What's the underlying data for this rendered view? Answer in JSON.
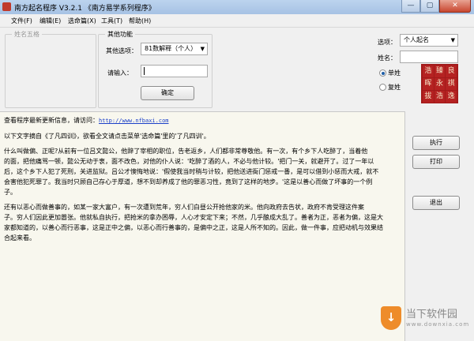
{
  "window": {
    "title": "南方起名程序 V3.2.1  《南方易学系列程序》",
    "controls": [
      "—",
      "▢",
      "✕"
    ]
  },
  "menu": [
    "文件(F)",
    "编辑(E)",
    "选命篇(X)",
    "工具(T)",
    "帮助(H)"
  ],
  "panels": {
    "names_group_title": "姓名五格",
    "other_group_title": "其他功能",
    "other_options_label": "其他选项：",
    "other_options_value": "81数解释（个人）",
    "input_label": "请输入：",
    "input_value": "",
    "confirm_button": "确定"
  },
  "right_panel": {
    "options_label": "选项：",
    "options_value": "个人起名",
    "surname_label": "姓名：",
    "surname_value": "",
    "radio_single": "单姓",
    "radio_double": "复姓",
    "radio_selected": "单姓",
    "logo_chars": [
      "浩",
      "臻",
      "良",
      "晖",
      "永",
      "祺",
      "拔",
      "浩",
      "逸"
    ],
    "execute_button": "执行",
    "print_button": "打印",
    "exit_button": "退出"
  },
  "content": {
    "update_prefix": "查看程序最新更新信息，请访问：",
    "update_link": "http://www.nfbaxi.com",
    "intro": "以下文字摘自《了凡四训》，欲看全文请点击菜单'选命篇'里的'了凡四训'。",
    "para1": [
      "    什么叫做偏、正呢?从前有一位吕文懿公，他辞了宰相的职位，告老返乡，人们都非常尊敬他。有一次，有个乡下人吃醉了，当着他",
      "的面，把他痛骂一顿，懿公无动于衷，面不改色，对他的仆人说：'吃醉了酒的人，不必与他计较。'把门一关，就避开了。过了一年以",
      "后，这个乡下人犯了死刑，关进监狱。吕公才懊悔地说：'假使我当时稍与计较，把他送进衙门惩戒一番，是可以借到小惩而大戒，就不",
      "会害他犯死罪了。我当时只顾自己存心于厚道，想不到却养成了他的罪恶习性，竟到了这样的地步。'这是以善心而做了坏事的一个例",
      "子。"
    ],
    "para2": [
      "    还有以恶心而做善事的，如某一家大富户，有一次遭到荒年，穷人们白昼公开抢他家的米。他向政府去告状，政府不肯受理这件案",
      "子。穷人们因此更加嚣张。他就私自执行，把抢米的拿办困辱，人心才安定下来；不然，几乎酿成大乱了。善者为正，恶者为偏，这是大",
      "家都知道的，以善心而行恶事，这是正中之偏，以恶心而行善事的，是偏中之正，这是人所不知的。因此，做一件事，应把动机与效果结",
      "合起来看。"
    ]
  },
  "watermark": {
    "brand_cn": "当下软件园",
    "brand_en": "www.downxia.com"
  }
}
